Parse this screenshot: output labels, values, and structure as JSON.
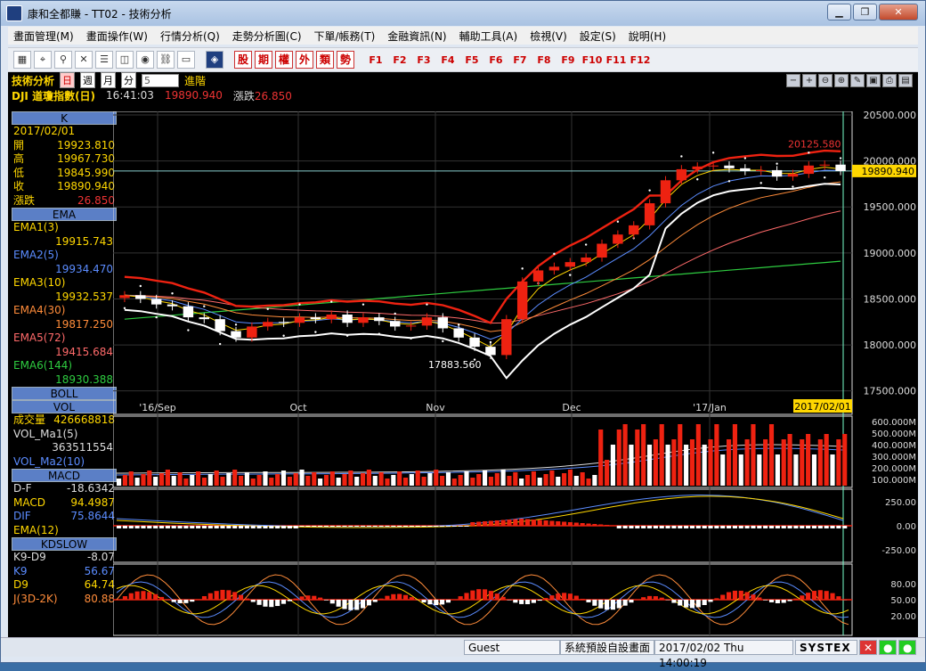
{
  "window": {
    "title": "康和全都賺 - TT02 - 技術分析",
    "minimize": "▁",
    "restore": "❐",
    "close": "✕"
  },
  "menu": [
    "畫面管理(M)",
    "畫面操作(W)",
    "行情分析(Q)",
    "走勢分析圖(C)",
    "下單/帳務(T)",
    "金融資訊(N)",
    "輔助工具(A)",
    "檢視(V)",
    "設定(S)",
    "說明(H)"
  ],
  "toolbar": {
    "icons": [
      "chart-type-icon",
      "pointer-icon",
      "zoom-icon",
      "cross-icon",
      "bar-icon",
      "split-icon",
      "globe-icon",
      "link-icon",
      "window-icon",
      "logo-icon"
    ],
    "red_buttons": [
      "股",
      "期",
      "權",
      "外",
      "類",
      "勢"
    ],
    "fkeys": [
      "F1",
      "F2",
      "F3",
      "F4",
      "F5",
      "F6",
      "F7",
      "F8",
      "F9",
      "F10",
      "F11",
      "F12"
    ]
  },
  "header": {
    "title": "技術分析",
    "tabs": [
      "日",
      "週",
      "月",
      "分"
    ],
    "active_tab": "日",
    "period_value": "5",
    "advanced": "進階",
    "symbol": "DJI 道瓊指數(日)",
    "time": "16:41:03",
    "last": "19890.940",
    "change_label": "漲跌",
    "change": "26.850"
  },
  "left_panel": {
    "k_header": "K",
    "date": "2017/02/01",
    "open_label": "開",
    "open": "19923.810",
    "high_label": "高",
    "high": "19967.730",
    "low_label": "低",
    "low": "19845.990",
    "close_label": "收",
    "close": "19890.940",
    "chg_label": "漲跌",
    "chg": "26.850",
    "ema_header": "EMA",
    "ema": [
      {
        "label": "EMA1(3)",
        "value": "19915.743",
        "arrow": "↓",
        "color": "#ffd700"
      },
      {
        "label": "EMA2(5)",
        "value": "19934.470",
        "arrow": "↓",
        "color": "#5b8cff"
      },
      {
        "label": "EMA3(10)",
        "value": "19932.537",
        "arrow": "↓",
        "color": "#ffd700"
      },
      {
        "label": "EMA4(30)",
        "value": "19817.250",
        "arrow": "↑",
        "color": "#ff8c3a"
      },
      {
        "label": "EMA5(72)",
        "value": "19415.684",
        "arrow": "↑",
        "color": "#ff6a6a"
      },
      {
        "label": "EMA6(144)",
        "value": "18930.388",
        "arrow": "↑",
        "color": "#2ecc40"
      }
    ],
    "boll_header": "BOLL",
    "vol_header": "VOL",
    "vol_label": "成交量",
    "vol": "426668818",
    "vol_ma1_label": "VOL_Ma1(5)",
    "vol_ma1": "363511554",
    "vol_ma2_label": "VOL_Ma2(10)",
    "macd_header": "MACD",
    "df_label": "D-F",
    "df": "-18.6342",
    "macd_label": "MACD",
    "macd": "94.4987",
    "dif_label": "DIF",
    "dif": "75.8644",
    "ema12_label": "EMA(12)",
    "kd_header": "KDSLOW",
    "k9d9_label": "K9-D9",
    "k9d9": "-8.07",
    "k9_label": "K9",
    "k9": "56.67",
    "d9_label": "D9",
    "d9": "64.74",
    "j_label": "J(3D-2K)",
    "j": "80.88"
  },
  "price_axis": [
    "20500.000",
    "20000.000",
    "19500.000",
    "19000.000",
    "18500.000",
    "18000.000",
    "17500.000"
  ],
  "price_tag": "19890.940",
  "high_annot": "20125.580",
  "low_annot": "17883.560",
  "x_labels": [
    "'16/Sep",
    "Oct",
    "Nov",
    "Dec",
    "'17/Jan"
  ],
  "cursor_date": "2017/02/01",
  "vol_axis": [
    "600.000M",
    "500.000M",
    "400.000M",
    "300.000M",
    "200.000M",
    "100.000M"
  ],
  "macd_axis": [
    "250.00",
    "0.00",
    "-250.00"
  ],
  "kd_axis": [
    "80.00",
    "50.00",
    "20.00"
  ],
  "status": {
    "user": "Guest",
    "layout": "系統預設自設畫面",
    "datetime": "2017/02/02 Thu 14:00:19",
    "brand": "SYSTEX"
  },
  "chart_data": {
    "type": "candlestick",
    "x_labels": [
      "'16/Sep",
      "Oct",
      "Nov",
      "Dec",
      "'17/Jan"
    ],
    "ylim": [
      17400,
      20500
    ],
    "close": [
      18540,
      18500,
      18440,
      18420,
      18300,
      18280,
      18150,
      18080,
      18200,
      18250,
      18240,
      18300,
      18280,
      18330,
      18240,
      18300,
      18260,
      18200,
      18210,
      18300,
      18180,
      18080,
      17980,
      17890,
      18280,
      18690,
      18810,
      18850,
      18900,
      18950,
      19100,
      19200,
      19300,
      19540,
      19790,
      19910,
      19940,
      19950,
      19920,
      19890,
      19900,
      19830,
      19860,
      19950,
      19960,
      19890
    ]
  }
}
